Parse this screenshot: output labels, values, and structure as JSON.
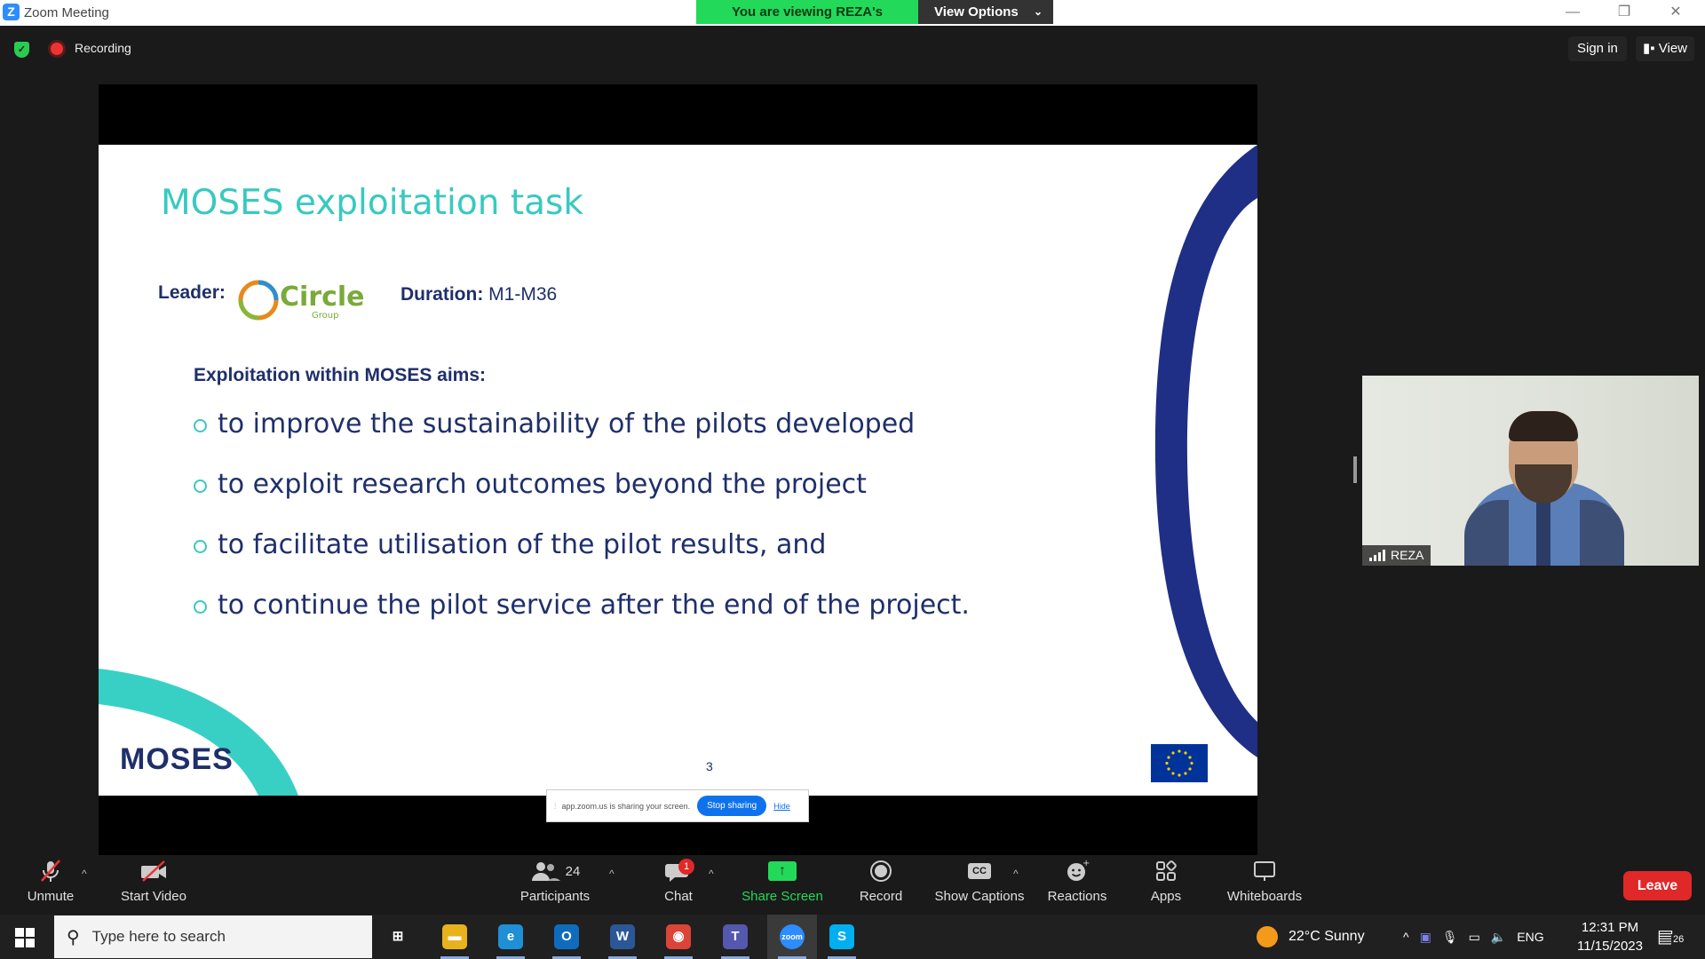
{
  "window": {
    "title": "Zoom Meeting",
    "banner_text": "You are viewing REZA's screen",
    "view_options": "View Options",
    "minimize": "—",
    "restore": "❐",
    "close": "✕"
  },
  "topbar": {
    "recording": "Recording",
    "sign_in": "Sign in",
    "view": "View"
  },
  "slide": {
    "title": "MOSES exploitation task",
    "leader_label": "Leader:",
    "leader_logo_text": "Circle",
    "leader_logo_sub": "Group",
    "duration_label": "Duration:",
    "duration_value": "M1-M36",
    "aims_heading": "Exploitation within MOSES aims:",
    "bullets": [
      "to improve the sustainability of the pilots developed",
      "to exploit research outcomes beyond the project",
      "to facilitate utilisation of the pilot results, and",
      "to continue the pilot service after the end of the project."
    ],
    "page_number": "3",
    "footer_logo": "MOSES",
    "colors": {
      "teal": "#38c9c0",
      "navy": "#1f2f6b"
    }
  },
  "share_notice": {
    "text": "app.zoom.us is sharing your screen.",
    "stop": "Stop sharing",
    "hide": "Hide"
  },
  "video": {
    "participant_name": "REZA"
  },
  "toolbar": {
    "unmute": "Unmute",
    "start_video": "Start Video",
    "participants": "Participants",
    "participant_count": "24",
    "chat": "Chat",
    "chat_badge": "1",
    "share_screen": "Share Screen",
    "record": "Record",
    "show_captions": "Show Captions",
    "captions_icon": "CC",
    "reactions": "Reactions",
    "apps": "Apps",
    "whiteboards": "Whiteboards",
    "leave": "Leave"
  },
  "taskbar": {
    "search_placeholder": "Type here to search",
    "weather": "22°C  Sunny",
    "language": "ENG",
    "time": "12:31 PM",
    "date": "11/15/2023",
    "notifications": "26",
    "apps": [
      {
        "name": "task-view",
        "glyph": "⊞",
        "color": "#202020"
      },
      {
        "name": "file-explorer",
        "glyph": "▬",
        "color": "#e8b21d"
      },
      {
        "name": "edge",
        "glyph": "e",
        "color": "#1f8fd6"
      },
      {
        "name": "outlook",
        "glyph": "O",
        "color": "#0f6cbd"
      },
      {
        "name": "word",
        "glyph": "W",
        "color": "#2b5797"
      },
      {
        "name": "chrome",
        "glyph": "◉",
        "color": "#db4437"
      },
      {
        "name": "teams",
        "glyph": "T",
        "color": "#5558af"
      },
      {
        "name": "zoom",
        "glyph": "zoom",
        "color": "#2d8cff"
      },
      {
        "name": "skype",
        "glyph": "S",
        "color": "#00aff0"
      }
    ]
  }
}
